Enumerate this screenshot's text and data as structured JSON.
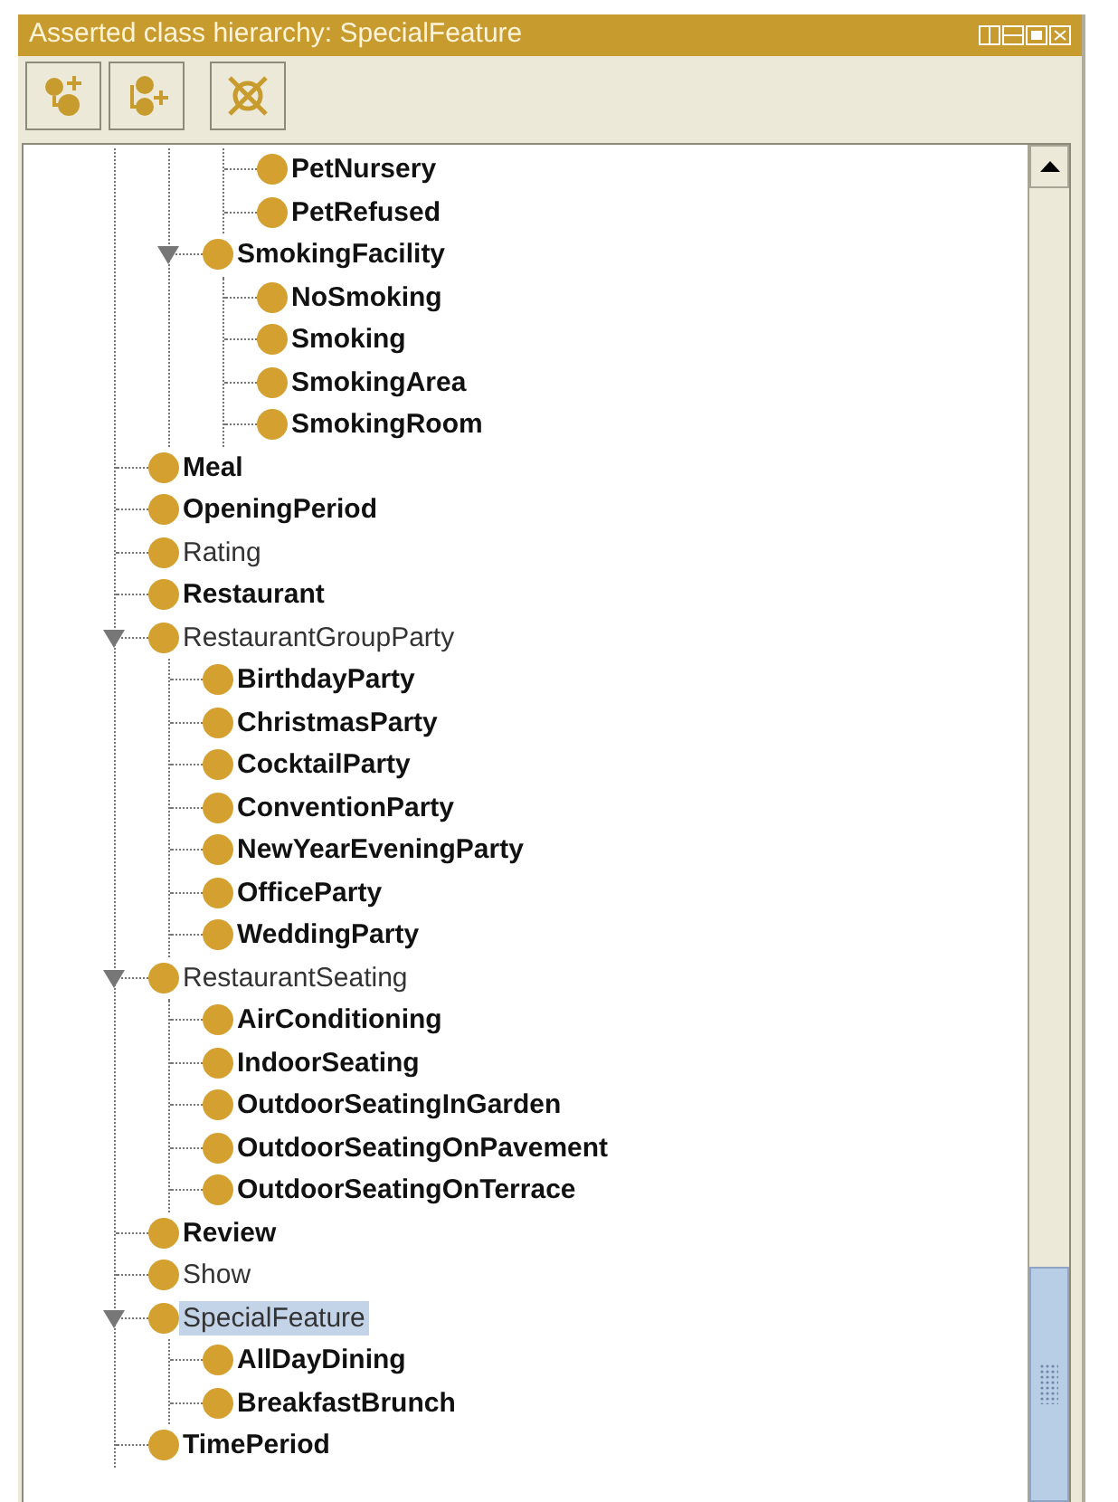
{
  "panel": {
    "title": "Asserted class hierarchy: SpecialFeature"
  },
  "tree": [
    {
      "children": [
        {
          "children": [
            {
              "label": "PetNursery",
              "bold": true,
              "selected": false
            },
            {
              "label": "PetRefused",
              "bold": true,
              "selected": false
            }
          ]
        },
        {
          "label": "SmokingFacility",
          "bold": true,
          "selected": false,
          "expanded": true,
          "children": [
            {
              "label": "NoSmoking",
              "bold": true,
              "selected": false
            },
            {
              "label": "Smoking",
              "bold": true,
              "selected": false
            },
            {
              "label": "SmokingArea",
              "bold": true,
              "selected": false
            },
            {
              "label": "SmokingRoom",
              "bold": true,
              "selected": false
            }
          ]
        }
      ]
    },
    {
      "label": "Meal",
      "bold": true,
      "selected": false
    },
    {
      "label": "OpeningPeriod",
      "bold": true,
      "selected": false
    },
    {
      "label": "Rating",
      "bold": false,
      "selected": false
    },
    {
      "label": "Restaurant",
      "bold": true,
      "selected": false
    },
    {
      "label": "RestaurantGroupParty",
      "bold": false,
      "selected": false,
      "expanded": true,
      "children": [
        {
          "label": "BirthdayParty",
          "bold": true,
          "selected": false
        },
        {
          "label": "ChristmasParty",
          "bold": true,
          "selected": false
        },
        {
          "label": "CocktailParty",
          "bold": true,
          "selected": false
        },
        {
          "label": "ConventionParty",
          "bold": true,
          "selected": false
        },
        {
          "label": "NewYearEveningParty",
          "bold": true,
          "selected": false
        },
        {
          "label": "OfficeParty",
          "bold": true,
          "selected": false
        },
        {
          "label": "WeddingParty",
          "bold": true,
          "selected": false
        }
      ]
    },
    {
      "label": "RestaurantSeating",
      "bold": false,
      "selected": false,
      "expanded": true,
      "children": [
        {
          "label": "AirConditioning",
          "bold": true,
          "selected": false
        },
        {
          "label": "IndoorSeating",
          "bold": true,
          "selected": false
        },
        {
          "label": "OutdoorSeatingInGarden",
          "bold": true,
          "selected": false
        },
        {
          "label": "OutdoorSeatingOnPavement",
          "bold": true,
          "selected": false
        },
        {
          "label": "OutdoorSeatingOnTerrace",
          "bold": true,
          "selected": false
        }
      ]
    },
    {
      "label": "Review",
      "bold": true,
      "selected": false
    },
    {
      "label": "Show",
      "bold": false,
      "selected": false
    },
    {
      "label": "SpecialFeature",
      "bold": false,
      "selected": true,
      "expanded": true,
      "children": [
        {
          "label": "AllDayDining",
          "bold": true,
          "selected": false
        },
        {
          "label": "BreakfastBrunch",
          "bold": true,
          "selected": false
        }
      ]
    },
    {
      "label": "TimePeriod",
      "bold": true,
      "selected": false
    }
  ]
}
